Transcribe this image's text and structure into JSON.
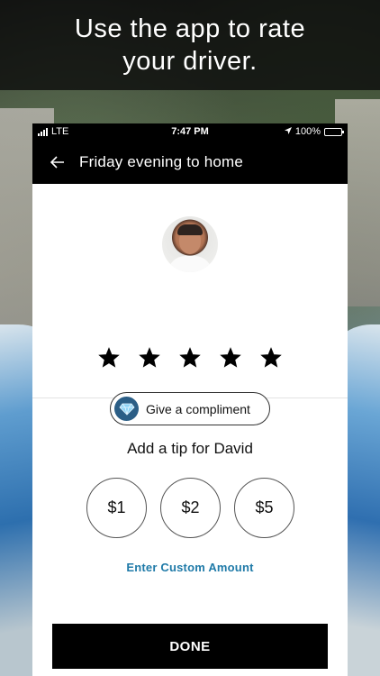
{
  "banner": {
    "line1": "Use the app to rate",
    "line2": "your driver."
  },
  "status_bar": {
    "carrier": "LTE",
    "time": "7:47 PM",
    "battery": "100%",
    "battery_level": 1.0
  },
  "nav": {
    "title": "Friday evening to home",
    "back_icon": "back-arrow-icon"
  },
  "rating": {
    "stars_total": 5,
    "stars_filled": 5,
    "compliment_label": "Give a compliment",
    "compliment_icon": "diamond-icon"
  },
  "tip": {
    "title": "Add a tip for David",
    "options": [
      "$1",
      "$2",
      "$5"
    ],
    "custom_label": "Enter Custom Amount"
  },
  "actions": {
    "done_label": "DONE"
  },
  "colors": {
    "accent_link": "#1f7aa8",
    "nav_bg": "#000000",
    "badge_bg": "#2b5e86"
  }
}
